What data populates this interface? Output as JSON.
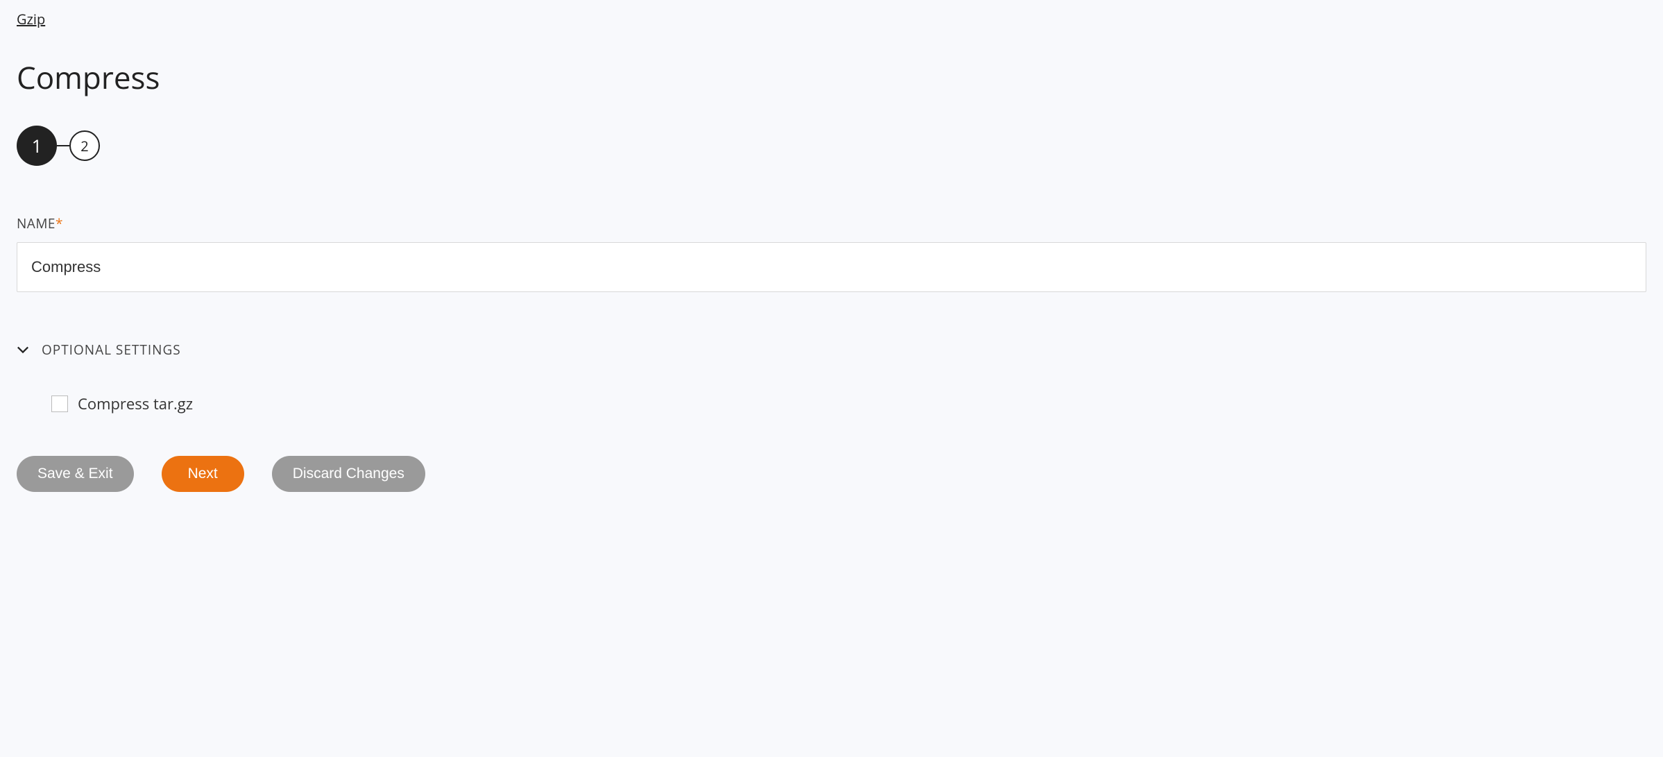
{
  "breadcrumb": {
    "label": "Gzip"
  },
  "page": {
    "title": "Compress"
  },
  "stepper": {
    "steps": [
      "1",
      "2"
    ],
    "active_index": 0
  },
  "form": {
    "name_label": "NAME",
    "name_value": "Compress"
  },
  "optional": {
    "header_label": "OPTIONAL SETTINGS",
    "expanded": true,
    "checkbox_label": "Compress tar.gz",
    "checkbox_checked": false
  },
  "actions": {
    "save_exit": "Save & Exit",
    "next": "Next",
    "discard": "Discard Changes"
  }
}
